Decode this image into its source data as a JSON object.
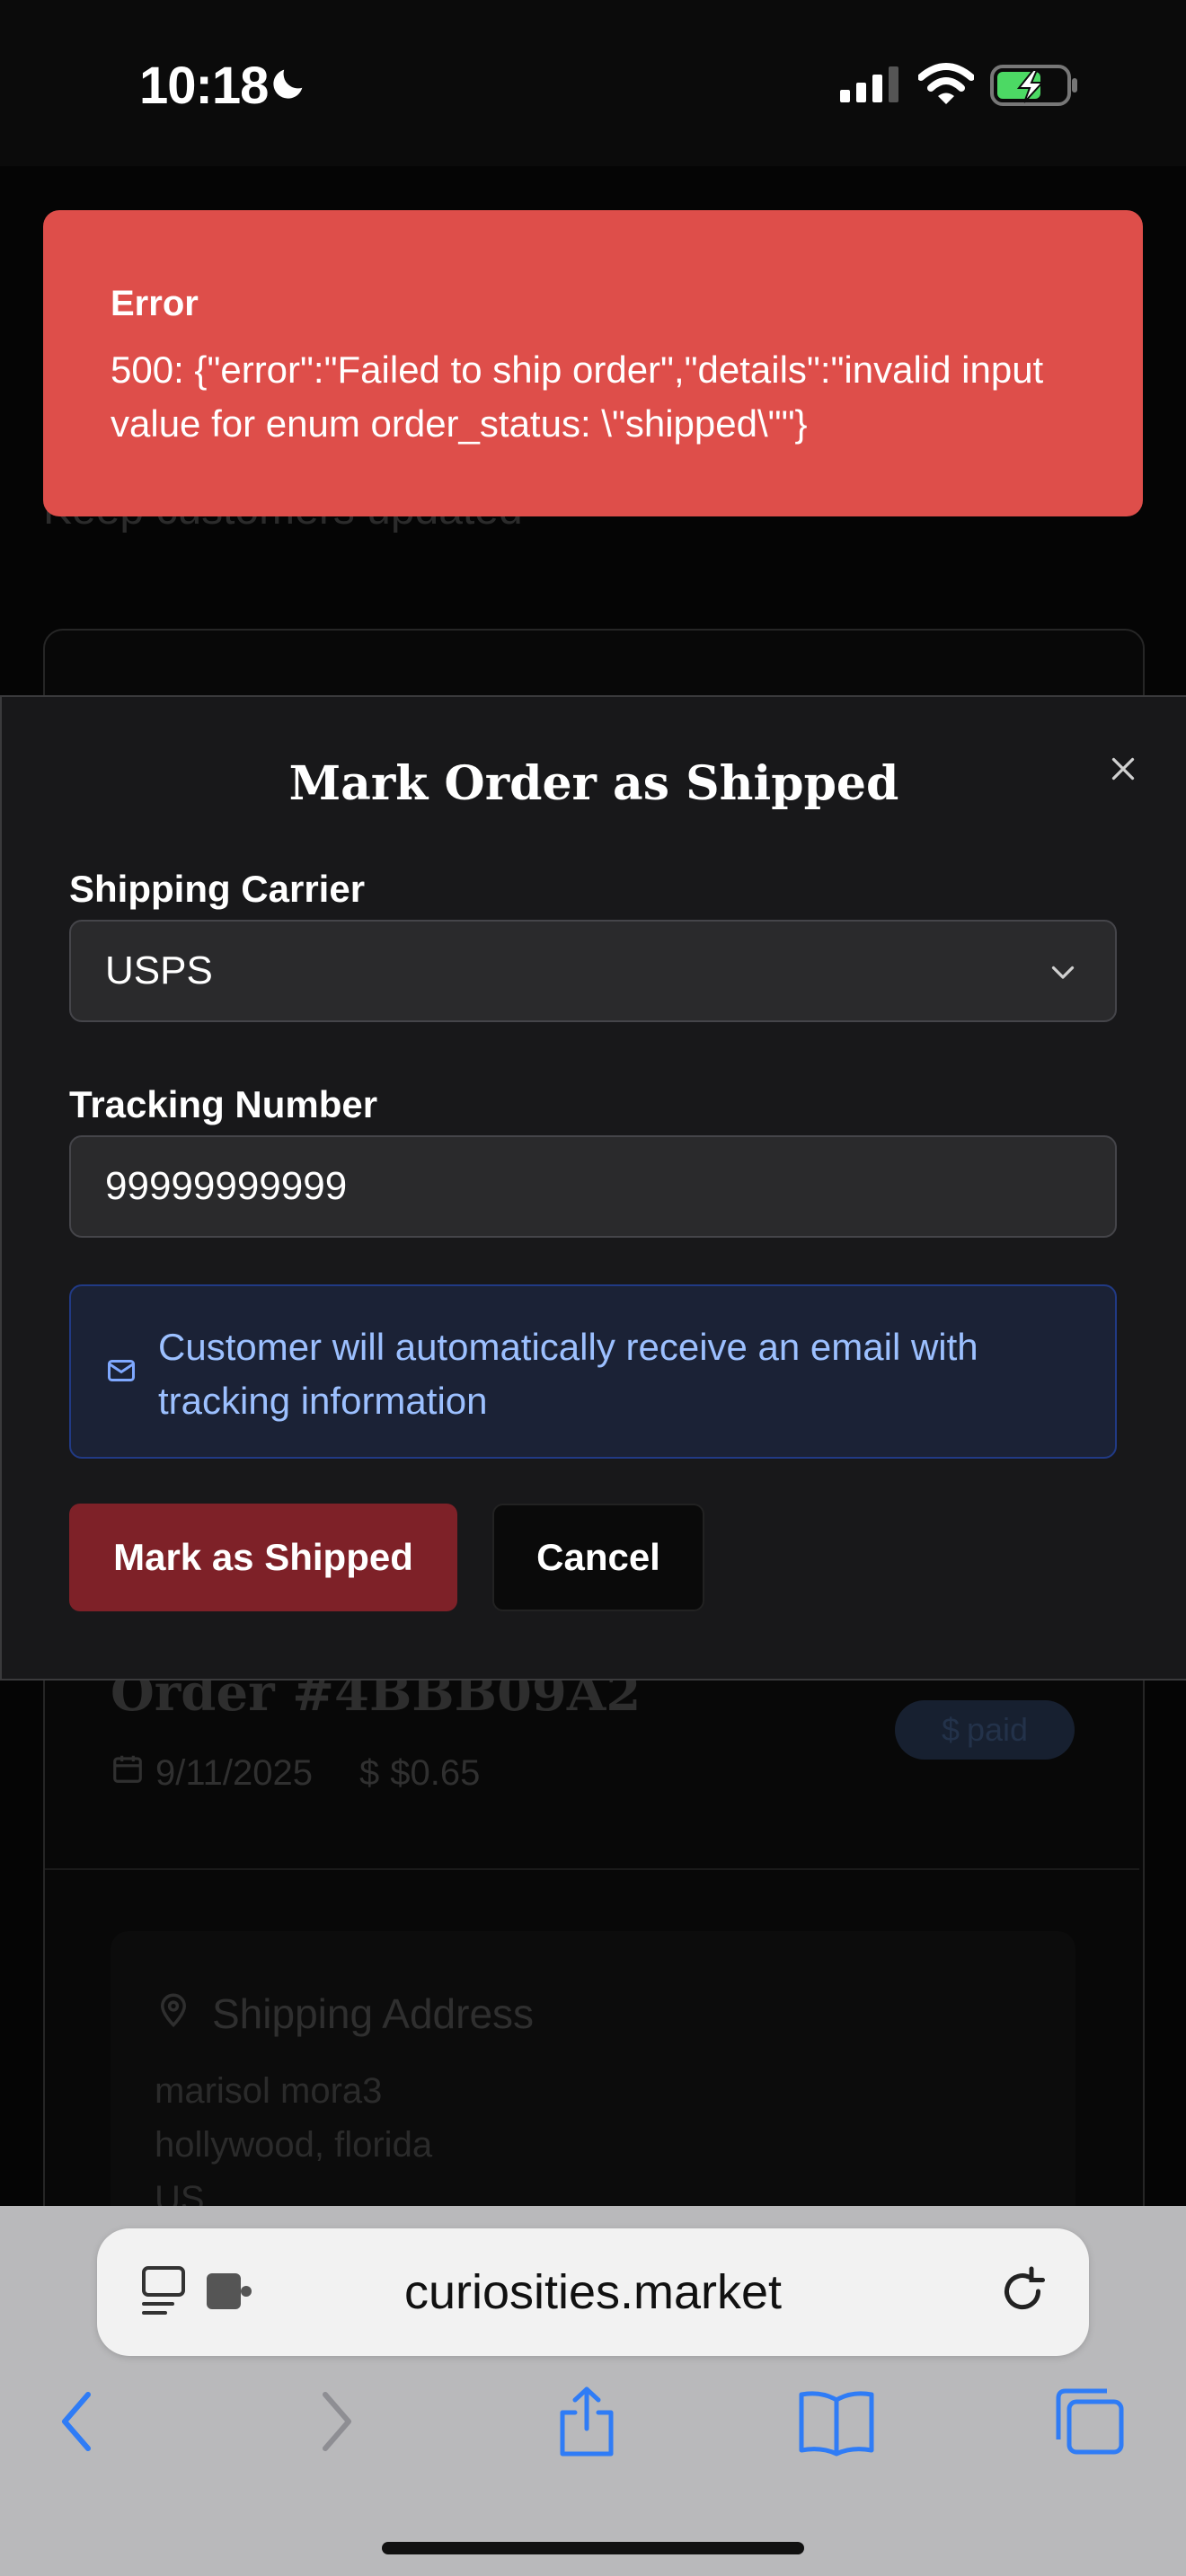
{
  "status_bar": {
    "time": "10:18"
  },
  "background_page": {
    "subtitle": "Keep customers updated",
    "order_title": "Order #4BBB09A2",
    "order_date": "9/11/2025",
    "order_total": "$0.65",
    "order_status_badge": "paid",
    "shipping_address_title": "Shipping Address",
    "address_lines": [
      "marisol mora3",
      "hollywood, florida",
      "US"
    ]
  },
  "error_toast": {
    "title": "Error",
    "message": "500: {\"error\":\"Failed to ship order\",\"details\":\"invalid input value for enum order_status: \\\"shipped\\\"\"}"
  },
  "modal": {
    "title": "Mark Order as Shipped",
    "carrier_label": "Shipping Carrier",
    "carrier_value": "USPS",
    "tracking_label": "Tracking Number",
    "tracking_value": "99999999999",
    "info_text": "Customer will automatically receive an email with tracking information",
    "submit_label": "Mark as Shipped",
    "cancel_label": "Cancel"
  },
  "browser": {
    "url": "curiosities.market"
  },
  "colors": {
    "toast": "#de4e4a",
    "primary_button": "#7e2128",
    "info_bg": "#1b2236",
    "info_text": "#9cc0ff",
    "browser_icon": "#2f7cf6"
  }
}
